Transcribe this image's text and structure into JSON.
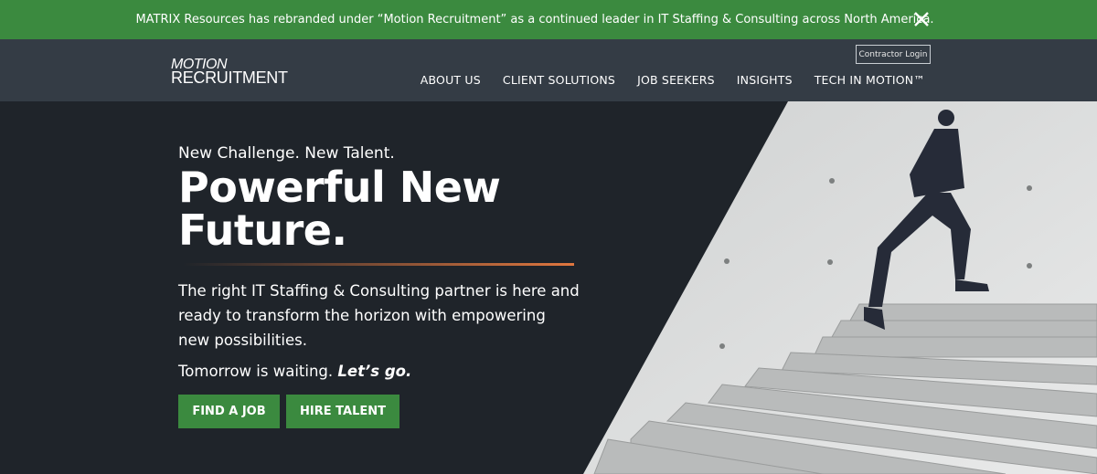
{
  "banner": {
    "text": "MATRIX Resources has rebranded under “Motion Recruitment” as a continued leader in IT Staffing & Consulting across North America.",
    "close_icon": "close-icon"
  },
  "header": {
    "logo": {
      "line1": "MOTION",
      "line2": "RECRUITMENT"
    },
    "contractor_login": "Contractor Login",
    "nav": [
      "ABOUT US",
      "CLIENT SOLUTIONS",
      "JOB SEEKERS",
      "INSIGHTS",
      "TECH IN MOTION™"
    ]
  },
  "hero": {
    "eyebrow": "New Challenge. New Talent.",
    "title_line1": "Powerful New",
    "title_line2": "Future.",
    "body": "The right IT Staffing & Consulting partner is here and ready to transform the horizon with empowering new possibilities.",
    "tagline": "Tomorrow is waiting.",
    "tagline_emphasis": "Let’s go.",
    "find_job": "FIND A JOB",
    "hire_talent": "HIRE TALENT"
  },
  "colors": {
    "green": "#3b8a3f",
    "header": "#343c45",
    "hero_bg": "#1f242a",
    "accent": "#e0773f"
  }
}
